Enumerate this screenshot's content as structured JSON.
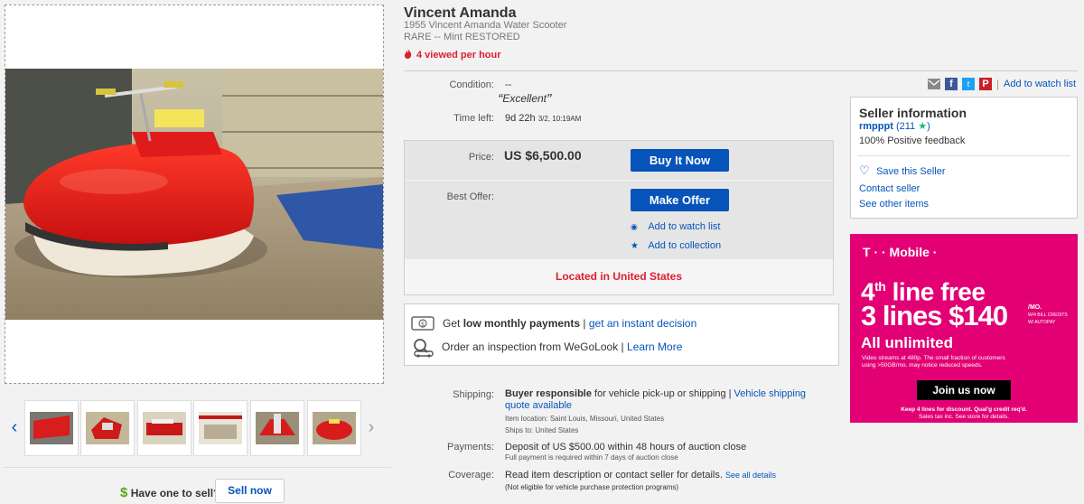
{
  "listing": {
    "title": "Vincent Amanda",
    "subtitle_line1": "1955 Vincent Amanda Water Scooter",
    "subtitle_line2": "RARE -- Mint RESTORED",
    "viewed": "4 viewed per hour"
  },
  "details": {
    "condition_label": "Condition:",
    "condition_value": "--",
    "condition_quote": "Excellent",
    "time_left_label": "Time left:",
    "time_left_value": "9d 22h",
    "time_left_date": "3/2, 10:19AM"
  },
  "pricing": {
    "price_label": "Price:",
    "price_value": "US $6,500.00",
    "buy_now": "Buy It Now",
    "best_offer_label": "Best Offer:",
    "make_offer": "Make Offer",
    "add_watch": "Add to watch list",
    "add_collection": "Add to collection",
    "located": "Located in United States"
  },
  "finance": {
    "payments_pre": "Get ",
    "payments_bold": "low monthly payments",
    "payments_sep": " | ",
    "payments_link": "get an instant decision",
    "inspection_text": "Order an inspection from WeGoLook",
    "inspection_sep": " | ",
    "inspection_link": "Learn More"
  },
  "shipping": {
    "label": "Shipping:",
    "bold": "Buyer responsible",
    "text": " for vehicle pick-up or shipping  |",
    "link1": "Vehicle shipping",
    "link2": "quote available",
    "location_label": "Item location:",
    "location_value": "Saint Louis, Missouri, United States",
    "ships_label": "Ships to:",
    "ships_value": "United States"
  },
  "payments": {
    "label": "Payments:",
    "line1": "Deposit of US $500.00 within 48 hours of auction close",
    "line2": "Full payment is required within 7 days of auction close"
  },
  "coverage": {
    "label": "Coverage:",
    "line1": "Read item description or contact seller for details.",
    "link": "See all details",
    "line2": "(Not eligible for vehicle purchase protection programs)"
  },
  "share": {
    "watch_link": "Add to watch list"
  },
  "seller": {
    "heading": "Seller information",
    "name": "rmpppt",
    "score": "(211",
    "score_close": ")",
    "feedback": "100% Positive feedback",
    "save": "Save this Seller",
    "contact": "Contact seller",
    "other": "See other items"
  },
  "ad": {
    "brand": "T · · Mobile ·",
    "line1_num": "4",
    "line1_sup": "th",
    "line1_rest": " line free",
    "line2_a": "3 lines ",
    "line2_price": "$140",
    "line2_mo": "/MO.",
    "line2_fine1": "W/4 BILL CREDITS",
    "line2_fine2": "W/ AUTOPAY",
    "line3": "All unlimited",
    "fine1": "Video streams at 480p. The small fraction of customers",
    "fine2": "using >50GB/mo. may notice reduced speeds.",
    "cta": "Join us now",
    "foot1": "Keep 4 lines for discount. Qual'g credit req'd.",
    "foot2": "Sales tax inc. See store for details."
  },
  "sell": {
    "dollar": "$",
    "question": "Have one to sell?",
    "button": "Sell now"
  },
  "colors": {
    "link": "#0654ba",
    "alert": "#dd1e31",
    "tmobile": "#e20074",
    "button": "#0654ba"
  }
}
